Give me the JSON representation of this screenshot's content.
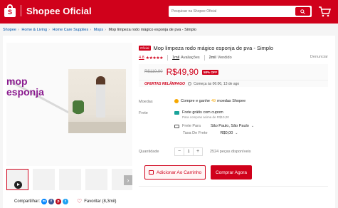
{
  "header": {
    "brand": "Shopee Oficial",
    "logo_letter": "S",
    "search_placeholder": "Pesquisar na Shopee Oficial"
  },
  "breadcrumb": [
    {
      "label": "Shopee"
    },
    {
      "label": "Home & Living"
    },
    {
      "label": "Home Care Supplies"
    },
    {
      "label": "Mops"
    },
    {
      "label": "Mop limpeza rodo mágico esponja de pva - Simplo"
    }
  ],
  "gallery": {
    "overlay_text_line1": "mop",
    "overlay_text_line2": "esponja",
    "next_arrow": "›"
  },
  "share": {
    "label": "Compartilhar:",
    "favorite": "Favoritar (8,3mil)"
  },
  "product": {
    "badge": "Oficial",
    "title": "Mop limpeza rodo mágico esponja de pva - Simplo",
    "rating": "4.8",
    "stars": "★★★★★",
    "reviews_count": "1mil",
    "reviews_label": "Avaliações",
    "sold_count": "2mil",
    "sold_label": "Vendido",
    "report": "Denunciar",
    "old_price": "R$119,90",
    "price": "R$49,90",
    "discount": "58% OFF",
    "flash_label": "OFERTAS RELÂMPAGO",
    "flash_text": "Começa às 06:00, 13 de ago"
  },
  "details": {
    "moedas_label": "Moedas",
    "moedas_text_pre": "Compre e ganhe",
    "moedas_count": "49",
    "moedas_text_post": "moedas Shopee",
    "frete_label": "Frete",
    "frete_free": "Frete grátis com cupom",
    "frete_sub": "Para compras acima de R$10,00",
    "frete_para_label": "Frete Para",
    "frete_para_value": "São Paulo, São Paulo",
    "taxa_label": "Taxa De Frete",
    "taxa_value": "R$0,00",
    "quantidade_label": "Quantidade",
    "qty_minus": "−",
    "qty_value": "1",
    "qty_plus": "+",
    "available": "2524 peças disponíveis"
  },
  "actions": {
    "add_cart": "Adicionar Ao Carrinho",
    "buy_now": "Comprar Agora"
  },
  "colors": {
    "accent": "#d0011b",
    "coin": "#f6a700"
  }
}
